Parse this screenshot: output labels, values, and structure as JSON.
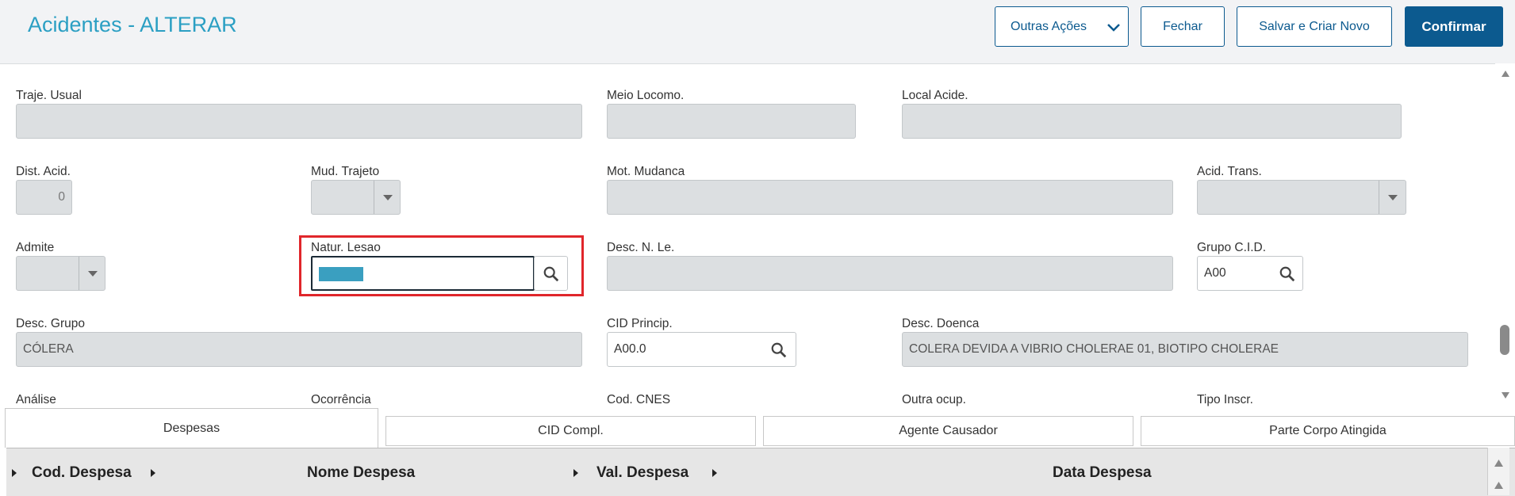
{
  "header": {
    "title": "Acidentes - ALTERAR",
    "buttons": {
      "more_actions": "Outras Ações",
      "close": "Fechar",
      "save_new": "Salvar e Criar Novo",
      "confirm": "Confirmar"
    }
  },
  "form": {
    "traje_usual": {
      "label": "Traje. Usual",
      "value": ""
    },
    "meio_locomo": {
      "label": "Meio Locomo.",
      "value": ""
    },
    "local_acide": {
      "label": "Local Acide.",
      "value": ""
    },
    "dist_acid": {
      "label": "Dist. Acid.",
      "value": "0"
    },
    "mud_trajeto": {
      "label": "Mud. Trajeto",
      "value": ""
    },
    "mot_mudanca": {
      "label": "Mot. Mudanca",
      "value": ""
    },
    "acid_trans": {
      "label": "Acid. Trans.",
      "value": ""
    },
    "admite": {
      "label": "Admite",
      "value": ""
    },
    "natur_lesao": {
      "label": "Natur. Lesao",
      "value": ""
    },
    "desc_n_le": {
      "label": "Desc. N. Le.",
      "value": ""
    },
    "grupo_cid": {
      "label": "Grupo C.I.D.",
      "value": "A00"
    },
    "desc_grupo": {
      "label": "Desc. Grupo",
      "value": "CÓLERA"
    },
    "cid_princip": {
      "label": "CID Princip.",
      "value": "A00.0"
    },
    "desc_doenca": {
      "label": "Desc. Doenca",
      "value": "COLERA DEVIDA A VIBRIO CHOLERAE 01, BIOTIPO CHOLERAE"
    },
    "analise": {
      "label": "Análise"
    },
    "ocorrencia": {
      "label": "Ocorrência"
    },
    "cod_cnes": {
      "label": "Cod. CNES"
    },
    "outra_ocup": {
      "label": "Outra ocup."
    },
    "tipo_inscr": {
      "label": "Tipo Inscr."
    }
  },
  "tabs": [
    {
      "label": "Despesas",
      "active": true
    },
    {
      "label": "CID Compl."
    },
    {
      "label": "Agente Causador"
    },
    {
      "label": "Parte Corpo Atingida"
    }
  ],
  "grid": {
    "columns": [
      "Cod. Despesa",
      "Nome Despesa",
      "Val. Despesa",
      "Data Despesa"
    ]
  },
  "colors": {
    "title": "#2b9fc3",
    "primary": "#0c5a8f",
    "highlight_box": "#e0262b",
    "selection": "#3a9fc0"
  },
  "icons": [
    "chevron-down-icon",
    "search-icon",
    "dropdown-arrow-icon",
    "scroll-up-icon",
    "scroll-down-icon",
    "sort-arrow-icon"
  ]
}
